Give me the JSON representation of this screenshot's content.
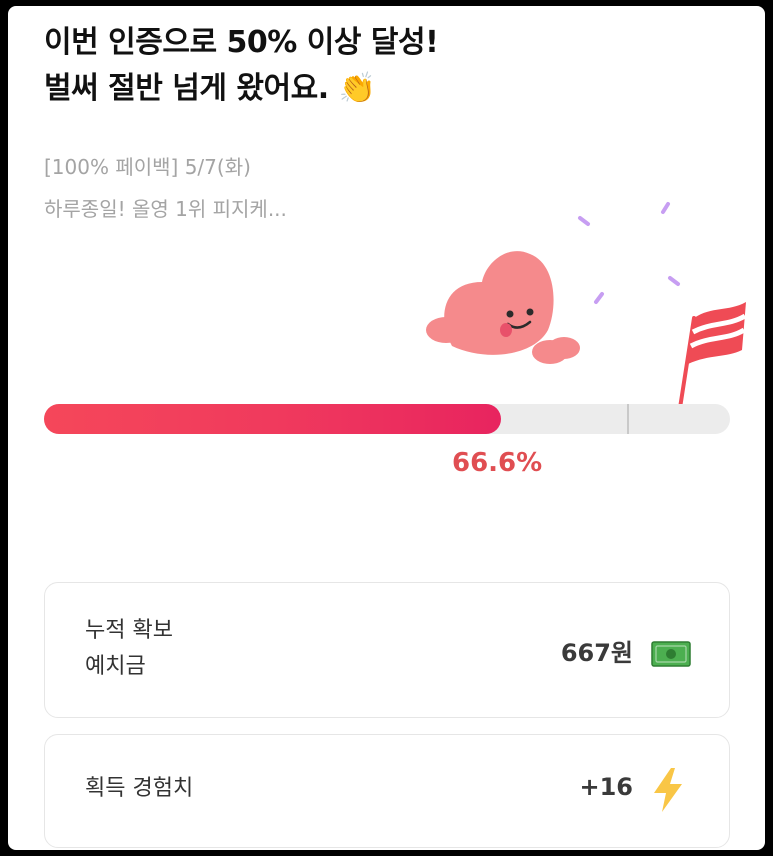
{
  "headline": {
    "line1": "이번 인증으로 50% 이상 달성!",
    "line2": "벌써 절반 넘게 왔어요.",
    "emoji": "👏"
  },
  "challenge": {
    "line1": "[100% 페이백] 5/7(화)",
    "line2": "하루종일! 올영 1위 피지케..."
  },
  "progress": {
    "percent": 66.6,
    "milestone": 85,
    "label": "66.6%",
    "fill_color": "#f03a5d"
  },
  "cards": {
    "deposit": {
      "label_line1": "누적 확보",
      "label_line2": "예치금",
      "value": "667원",
      "icon": "money-icon"
    },
    "exp": {
      "label": "획득 경험치",
      "value": "+16",
      "icon": "lightning-icon"
    }
  },
  "colors": {
    "accent": "#e04e52",
    "mascot": "#f58a8c",
    "flag": "#ef4b55",
    "confetti": "#c79ef2",
    "bolt": "#f9c646"
  }
}
